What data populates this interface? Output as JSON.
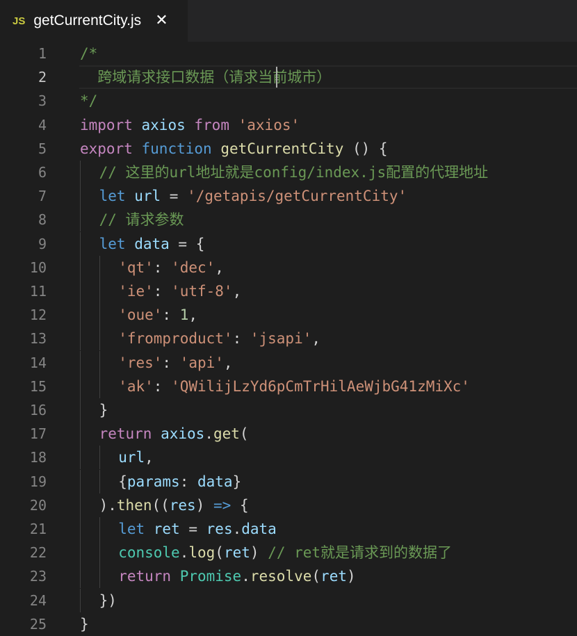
{
  "tab": {
    "icon": "JS",
    "icon_name": "javascript-file-icon",
    "title": "getCurrentCity.js",
    "close_glyph": "✕"
  },
  "colors": {
    "background": "#1e1e1e",
    "tab_bar": "#252526",
    "line_number": "#858585",
    "comment": "#6a9955",
    "keyword": "#c586c0",
    "storage": "#569cd6",
    "variable": "#9cdcfe",
    "string": "#ce9178",
    "function": "#dcdcaa",
    "number": "#b5cea8",
    "class": "#4ec9b0"
  },
  "editor": {
    "current_line": 2,
    "lines": [
      {
        "n": "1",
        "indent": 0,
        "tokens": [
          {
            "t": "/*",
            "c": "comment"
          }
        ]
      },
      {
        "n": "2",
        "indent": 0,
        "tokens": [
          {
            "t": "  跨域请求接口数据（请求当前城市）",
            "c": "comment"
          }
        ]
      },
      {
        "n": "3",
        "indent": 0,
        "tokens": [
          {
            "t": "*/",
            "c": "comment"
          }
        ]
      },
      {
        "n": "4",
        "indent": 0,
        "tokens": [
          {
            "t": "import",
            "c": "keyword"
          },
          {
            "t": " "
          },
          {
            "t": "axios",
            "c": "var"
          },
          {
            "t": " "
          },
          {
            "t": "from",
            "c": "keyword"
          },
          {
            "t": " "
          },
          {
            "t": "'axios'",
            "c": "string"
          }
        ]
      },
      {
        "n": "5",
        "indent": 0,
        "tokens": [
          {
            "t": "export",
            "c": "keyword"
          },
          {
            "t": " "
          },
          {
            "t": "function",
            "c": "storage"
          },
          {
            "t": " "
          },
          {
            "t": "getCurrentCity",
            "c": "func"
          },
          {
            "t": " () {"
          }
        ]
      },
      {
        "n": "6",
        "indent": 1,
        "tokens": [
          {
            "t": "// 这里的url地址就是config/index.js配置的代理地址",
            "c": "comment"
          }
        ]
      },
      {
        "n": "7",
        "indent": 1,
        "tokens": [
          {
            "t": "let",
            "c": "storage"
          },
          {
            "t": " "
          },
          {
            "t": "url",
            "c": "var"
          },
          {
            "t": " = "
          },
          {
            "t": "'/getapis/getCurrentCity'",
            "c": "string"
          }
        ]
      },
      {
        "n": "8",
        "indent": 1,
        "tokens": [
          {
            "t": "// 请求参数",
            "c": "comment"
          }
        ]
      },
      {
        "n": "9",
        "indent": 1,
        "tokens": [
          {
            "t": "let",
            "c": "storage"
          },
          {
            "t": " "
          },
          {
            "t": "data",
            "c": "var"
          },
          {
            "t": " = {"
          }
        ]
      },
      {
        "n": "10",
        "indent": 2,
        "tokens": [
          {
            "t": "'qt'",
            "c": "string"
          },
          {
            "t": ": "
          },
          {
            "t": "'dec'",
            "c": "string"
          },
          {
            "t": ","
          }
        ]
      },
      {
        "n": "11",
        "indent": 2,
        "tokens": [
          {
            "t": "'ie'",
            "c": "string"
          },
          {
            "t": ": "
          },
          {
            "t": "'utf-8'",
            "c": "string"
          },
          {
            "t": ","
          }
        ]
      },
      {
        "n": "12",
        "indent": 2,
        "tokens": [
          {
            "t": "'oue'",
            "c": "string"
          },
          {
            "t": ": "
          },
          {
            "t": "1",
            "c": "number"
          },
          {
            "t": ","
          }
        ]
      },
      {
        "n": "13",
        "indent": 2,
        "tokens": [
          {
            "t": "'fromproduct'",
            "c": "string"
          },
          {
            "t": ": "
          },
          {
            "t": "'jsapi'",
            "c": "string"
          },
          {
            "t": ","
          }
        ]
      },
      {
        "n": "14",
        "indent": 2,
        "tokens": [
          {
            "t": "'res'",
            "c": "string"
          },
          {
            "t": ": "
          },
          {
            "t": "'api'",
            "c": "string"
          },
          {
            "t": ","
          }
        ]
      },
      {
        "n": "15",
        "indent": 2,
        "tokens": [
          {
            "t": "'ak'",
            "c": "string"
          },
          {
            "t": ": "
          },
          {
            "t": "'QWilijLzYd6pCmTrHilAeWjbG41zMiXc'",
            "c": "string"
          }
        ]
      },
      {
        "n": "16",
        "indent": 1,
        "tokens": [
          {
            "t": "}"
          }
        ]
      },
      {
        "n": "17",
        "indent": 1,
        "tokens": [
          {
            "t": "return",
            "c": "keyword"
          },
          {
            "t": " "
          },
          {
            "t": "axios",
            "c": "var"
          },
          {
            "t": "."
          },
          {
            "t": "get",
            "c": "func"
          },
          {
            "t": "("
          }
        ]
      },
      {
        "n": "18",
        "indent": 2,
        "tokens": [
          {
            "t": "url",
            "c": "var"
          },
          {
            "t": ","
          }
        ]
      },
      {
        "n": "19",
        "indent": 2,
        "tokens": [
          {
            "t": "{"
          },
          {
            "t": "params",
            "c": "var"
          },
          {
            "t": ": "
          },
          {
            "t": "data",
            "c": "var"
          },
          {
            "t": "}"
          }
        ]
      },
      {
        "n": "20",
        "indent": 1,
        "tokens": [
          {
            "t": ")."
          },
          {
            "t": "then",
            "c": "func"
          },
          {
            "t": "(("
          },
          {
            "t": "res",
            "c": "var"
          },
          {
            "t": ") "
          },
          {
            "t": "=>",
            "c": "storage"
          },
          {
            "t": " {"
          }
        ]
      },
      {
        "n": "21",
        "indent": 2,
        "tokens": [
          {
            "t": "let",
            "c": "storage"
          },
          {
            "t": " "
          },
          {
            "t": "ret",
            "c": "var"
          },
          {
            "t": " = "
          },
          {
            "t": "res",
            "c": "var"
          },
          {
            "t": "."
          },
          {
            "t": "data",
            "c": "var"
          }
        ]
      },
      {
        "n": "22",
        "indent": 2,
        "tokens": [
          {
            "t": "console",
            "c": "class"
          },
          {
            "t": "."
          },
          {
            "t": "log",
            "c": "func"
          },
          {
            "t": "("
          },
          {
            "t": "ret",
            "c": "var"
          },
          {
            "t": ") "
          },
          {
            "t": "// ret就是请求到的数据了",
            "c": "comment"
          }
        ]
      },
      {
        "n": "23",
        "indent": 2,
        "tokens": [
          {
            "t": "return",
            "c": "keyword"
          },
          {
            "t": " "
          },
          {
            "t": "Promise",
            "c": "class"
          },
          {
            "t": "."
          },
          {
            "t": "resolve",
            "c": "func"
          },
          {
            "t": "("
          },
          {
            "t": "ret",
            "c": "var"
          },
          {
            "t": ")"
          }
        ]
      },
      {
        "n": "24",
        "indent": 1,
        "tokens": [
          {
            "t": "})"
          }
        ]
      },
      {
        "n": "25",
        "indent": 0,
        "tokens": [
          {
            "t": "}"
          }
        ]
      }
    ]
  }
}
